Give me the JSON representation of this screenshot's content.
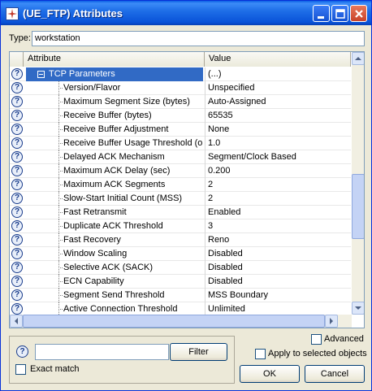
{
  "window": {
    "title": "(UE_FTP) Attributes",
    "accent_color": "#0a5fe4",
    "selection_color": "#316ac5"
  },
  "type_field": {
    "label": "Type:",
    "value": "workstation"
  },
  "grid": {
    "columns": {
      "attribute": "Attribute",
      "value": "Value"
    },
    "group": {
      "label": "TCP Parameters",
      "value": "(...)"
    },
    "rows": [
      {
        "attribute": "Version/Flavor",
        "value": "Unspecified"
      },
      {
        "attribute": "Maximum Segment Size (bytes)",
        "value": "Auto-Assigned"
      },
      {
        "attribute": "Receive Buffer (bytes)",
        "value": "65535"
      },
      {
        "attribute": "Receive Buffer Adjustment",
        "value": "None"
      },
      {
        "attribute": "Receive Buffer Usage Threshold (o...",
        "value": "1.0"
      },
      {
        "attribute": "Delayed ACK Mechanism",
        "value": "Segment/Clock Based"
      },
      {
        "attribute": "Maximum ACK Delay (sec)",
        "value": "0.200"
      },
      {
        "attribute": "Maximum ACK Segments",
        "value": "2"
      },
      {
        "attribute": "Slow-Start Initial Count (MSS)",
        "value": "2"
      },
      {
        "attribute": "Fast Retransmit",
        "value": "Enabled"
      },
      {
        "attribute": "Duplicate ACK Threshold",
        "value": "3"
      },
      {
        "attribute": "Fast Recovery",
        "value": "Reno"
      },
      {
        "attribute": "Window Scaling",
        "value": "Disabled"
      },
      {
        "attribute": "Selective ACK (SACK)",
        "value": "Disabled"
      },
      {
        "attribute": "ECN Capability",
        "value": "Disabled"
      },
      {
        "attribute": "Segment Send Threshold",
        "value": "MSS Boundary"
      },
      {
        "attribute": "Active Connection Threshold",
        "value": "Unlimited"
      }
    ]
  },
  "filter": {
    "input_value": "",
    "button_label": "Filter",
    "exact_match_label": "Exact match"
  },
  "options": {
    "advanced_label": "Advanced",
    "apply_label": "Apply to selected objects"
  },
  "buttons": {
    "ok": "OK",
    "cancel": "Cancel"
  },
  "icons": {
    "help": "question-mark-icon",
    "title": "opnet-node-icon",
    "minimize": "minimize-icon",
    "maximize": "maximize-icon",
    "close": "close-icon"
  }
}
